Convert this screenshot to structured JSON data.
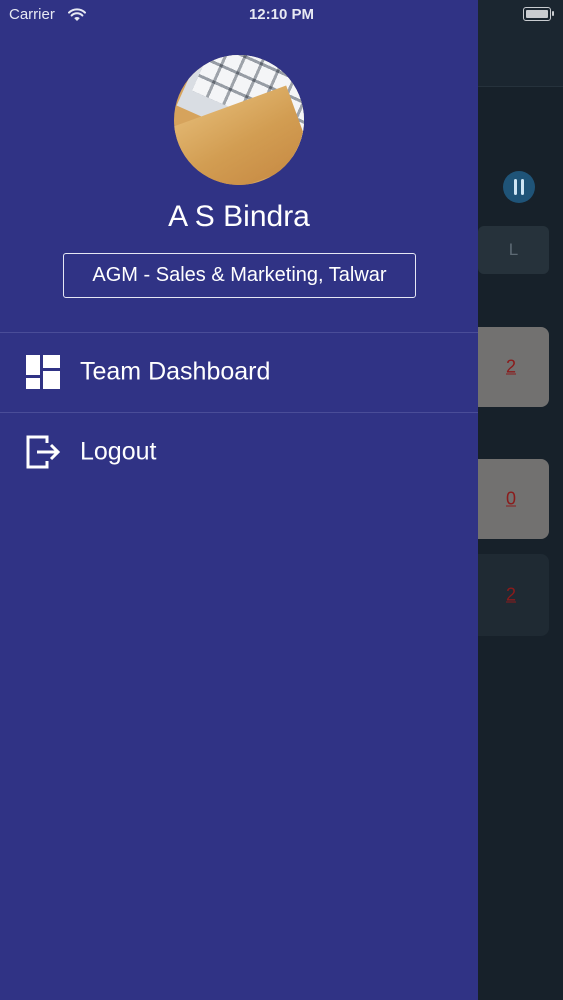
{
  "status_bar": {
    "carrier": "Carrier",
    "time": "12:10 PM"
  },
  "drawer": {
    "user": {
      "name": "A S Bindra",
      "role": "AGM - Sales & Marketing, Talwar"
    },
    "menu": [
      {
        "label": "Team Dashboard",
        "icon": "dashboard-icon"
      },
      {
        "label": "Logout",
        "icon": "logout-icon"
      }
    ]
  },
  "background": {
    "segment_label": "L",
    "card_values": [
      "2",
      "0",
      "2"
    ]
  },
  "colors": {
    "drawer_bg": "#303385",
    "overlay_bg": "#17212a",
    "accent_number": "#8b1b1b"
  }
}
